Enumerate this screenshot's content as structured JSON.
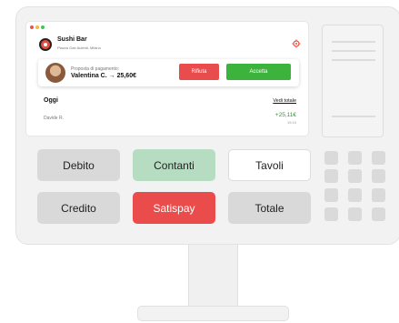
{
  "screen": {
    "window_dots": [
      "#f0504b",
      "#f4b740",
      "#3fc450"
    ],
    "shop": {
      "name": "Sushi Bar",
      "address": "Piazza Gae Aulenti, Milano",
      "logo_icon": "sushi-logo-icon"
    },
    "settings_icon": "gear-icon",
    "payment_request": {
      "label": "Proposta di pagamento:",
      "value": "Valentina C. → 25,60€",
      "reject_label": "Rifiuta",
      "accept_label": "Accetta"
    },
    "today": {
      "title": "Oggi",
      "see_all": "Vedi totale",
      "transactions": [
        {
          "name": "Davide R.",
          "amount": "+25,11€",
          "time": "19:10"
        }
      ]
    }
  },
  "pos_buttons": {
    "debito": "Debito",
    "contanti": "Contanti",
    "tavoli": "Tavoli",
    "credito": "Credito",
    "satispay": "Satispay",
    "totale": "Totale"
  },
  "colors": {
    "accept": "#3cb33c",
    "reject": "#e84c4c",
    "satispay": "#ea4c4c",
    "contanti": "#b6ddc1",
    "amount_positive": "#2e9e2e"
  }
}
